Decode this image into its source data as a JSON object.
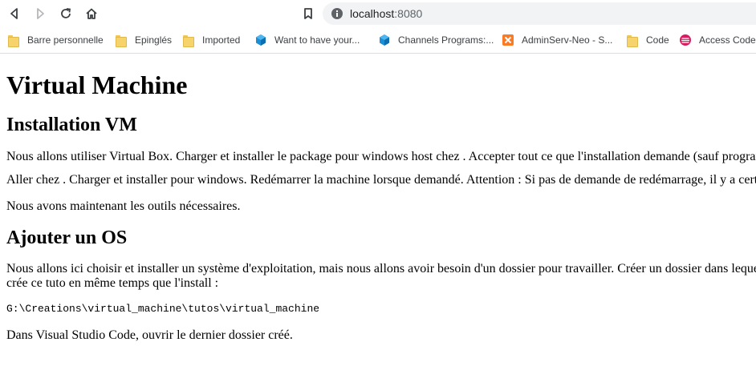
{
  "browser": {
    "url_host": "localhost",
    "url_port": ":8080",
    "bookmarks": [
      {
        "label": "Barre personnelle",
        "icon": "folder-icon"
      },
      {
        "label": "Epinglés",
        "icon": "folder-icon"
      },
      {
        "label": "Imported",
        "icon": "folder-icon"
      },
      {
        "label": "Want to have your...",
        "icon": "cube-icon"
      },
      {
        "label": "Channels Programs:...",
        "icon": "cube-icon"
      },
      {
        "label": "AdminServ-Neo - S...",
        "icon": "xampp-icon"
      },
      {
        "label": "Code",
        "icon": "folder-icon"
      },
      {
        "label": "Access Code",
        "icon": "access-icon"
      }
    ]
  },
  "page": {
    "title": "Virtual Machine",
    "section1": {
      "heading": "Installation VM",
      "p1": "Nous allons utiliser Virtual Box. Charger et installer le package pour windows host chez . Accepter tout ce que l'installation demande (sauf programmes",
      "p2": "Aller chez . Charger et installer pour windows. Redémarrer la machine lorsque demandé. Attention : Si pas de demande de redémarrage, il y a certain",
      "p3": "Nous avons maintenant les outils nécessaires."
    },
    "section2": {
      "heading": "Ajouter un OS",
      "p1_line1": "Nous allons ici choisir et installer un système d'exploitation, mais nous allons avoir besoin d'un dossier pour travailler. Créer un dossier dans lequel",
      "p1_line2": "crée ce tuto en même temps que l'install :",
      "code": "G:\\Creations\\virtual_machine\\tutos\\virtual_machine",
      "p2": "Dans Visual Studio Code, ouvrir le dernier dossier créé."
    }
  }
}
